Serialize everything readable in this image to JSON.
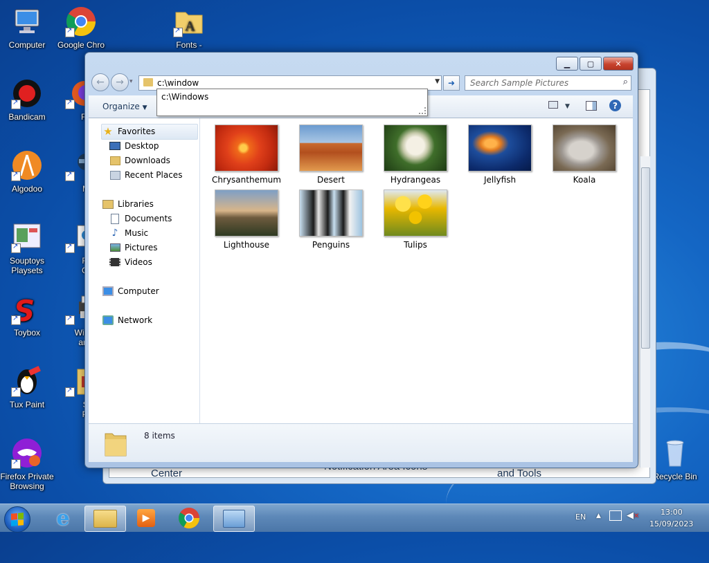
{
  "desktop": {
    "icons": [
      {
        "label": "Computer"
      },
      {
        "label": "Google Chro"
      },
      {
        "label": "Fonts -"
      },
      {
        "label": "Bandicam"
      },
      {
        "label": "Firef"
      },
      {
        "label": "Algodoo"
      },
      {
        "label": "MAS"
      },
      {
        "label": "Souptoys Playsets"
      },
      {
        "label": "Recti Conti"
      },
      {
        "label": "Toybox"
      },
      {
        "label": "Window and S"
      },
      {
        "label": "Tux Paint"
      },
      {
        "label": "Sam Pictu"
      },
      {
        "label": "Firefox Private Browsing"
      },
      {
        "label": "Recycle Bin"
      }
    ]
  },
  "back_window": {
    "fragments": [
      "Center",
      "Notification Area Icons",
      "and Tools"
    ]
  },
  "explorer": {
    "address_value": "c:\\window",
    "search_placeholder": "Search Sample Pictures",
    "autocomplete": [
      "c:\\Windows"
    ],
    "organize_label": "Organize",
    "nav": {
      "favorites": {
        "label": "Favorites",
        "items": [
          "Desktop",
          "Downloads",
          "Recent Places"
        ]
      },
      "libraries": {
        "label": "Libraries",
        "items": [
          "Documents",
          "Music",
          "Pictures",
          "Videos"
        ]
      },
      "computer": "Computer",
      "network": "Network"
    },
    "files": [
      "Chrysanthemum",
      "Desert",
      "Hydrangeas",
      "Jellyfish",
      "Koala",
      "Lighthouse",
      "Penguins",
      "Tulips"
    ],
    "status": "8 items"
  },
  "taskbar": {
    "language": "EN",
    "time": "13:00",
    "date": "15/09/2023"
  }
}
